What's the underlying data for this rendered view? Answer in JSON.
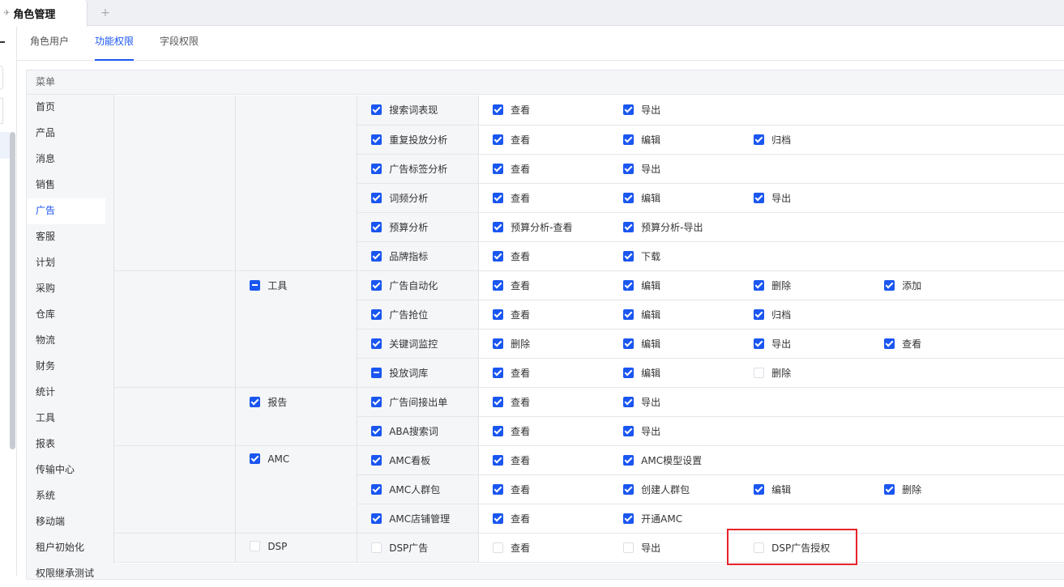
{
  "tabbar": {
    "active_tab": "角色管理",
    "add_tab": "+"
  },
  "subtabs": [
    {
      "label": "角色用户",
      "active": false
    },
    {
      "label": "功能权限",
      "active": true
    },
    {
      "label": "字段权限",
      "active": false
    }
  ],
  "panel": {
    "header": "菜单"
  },
  "menu": [
    {
      "label": "首页"
    },
    {
      "label": "产品"
    },
    {
      "label": "消息"
    },
    {
      "label": "销售"
    },
    {
      "label": "广告",
      "active": true
    },
    {
      "label": "客服"
    },
    {
      "label": "计划"
    },
    {
      "label": "采购"
    },
    {
      "label": "仓库"
    },
    {
      "label": "物流"
    },
    {
      "label": "财务"
    },
    {
      "label": "统计"
    },
    {
      "label": "工具"
    },
    {
      "label": "报表"
    },
    {
      "label": "传输中心"
    },
    {
      "label": "系统"
    },
    {
      "label": "移动端"
    },
    {
      "label": "租户初始化"
    },
    {
      "label": "权限继承测试"
    }
  ],
  "groups": [
    {
      "label": null,
      "state": null,
      "rows": [
        {
          "label": "搜索词表现",
          "state": "checked",
          "perms": [
            {
              "label": "查看",
              "state": "checked"
            },
            {
              "label": "导出",
              "state": "checked"
            }
          ]
        },
        {
          "label": "重复投放分析",
          "state": "checked",
          "perms": [
            {
              "label": "查看",
              "state": "checked"
            },
            {
              "label": "编辑",
              "state": "checked"
            },
            {
              "label": "归档",
              "state": "checked"
            }
          ]
        },
        {
          "label": "广告标签分析",
          "state": "checked",
          "perms": [
            {
              "label": "查看",
              "state": "checked"
            },
            {
              "label": "导出",
              "state": "checked"
            }
          ]
        },
        {
          "label": "词频分析",
          "state": "checked",
          "perms": [
            {
              "label": "查看",
              "state": "checked"
            },
            {
              "label": "编辑",
              "state": "checked"
            },
            {
              "label": "导出",
              "state": "checked"
            }
          ]
        },
        {
          "label": "预算分析",
          "state": "checked",
          "perms": [
            {
              "label": "预算分析-查看",
              "state": "checked"
            },
            {
              "label": "预算分析-导出",
              "state": "checked"
            }
          ]
        },
        {
          "label": "品牌指标",
          "state": "checked",
          "perms": [
            {
              "label": "查看",
              "state": "checked"
            },
            {
              "label": "下载",
              "state": "checked"
            }
          ]
        }
      ]
    },
    {
      "label": "工具",
      "state": "partial",
      "rows": [
        {
          "label": "广告自动化",
          "state": "checked",
          "perms": [
            {
              "label": "查看",
              "state": "checked"
            },
            {
              "label": "编辑",
              "state": "checked"
            },
            {
              "label": "删除",
              "state": "checked"
            },
            {
              "label": "添加",
              "state": "checked"
            }
          ]
        },
        {
          "label": "广告抢位",
          "state": "checked",
          "perms": [
            {
              "label": "查看",
              "state": "checked"
            },
            {
              "label": "编辑",
              "state": "checked"
            },
            {
              "label": "归档",
              "state": "checked"
            }
          ]
        },
        {
          "label": "关键词监控",
          "state": "checked",
          "perms": [
            {
              "label": "删除",
              "state": "checked"
            },
            {
              "label": "编辑",
              "state": "checked"
            },
            {
              "label": "导出",
              "state": "checked"
            },
            {
              "label": "查看",
              "state": "checked"
            }
          ]
        },
        {
          "label": "投放词库",
          "state": "partial",
          "perms": [
            {
              "label": "查看",
              "state": "checked"
            },
            {
              "label": "编辑",
              "state": "checked"
            },
            {
              "label": "删除",
              "state": "unchecked"
            }
          ]
        }
      ]
    },
    {
      "label": "报告",
      "state": "checked",
      "rows": [
        {
          "label": "广告间接出单",
          "state": "checked",
          "perms": [
            {
              "label": "查看",
              "state": "checked"
            },
            {
              "label": "导出",
              "state": "checked"
            }
          ]
        },
        {
          "label": "ABA搜索词",
          "state": "checked",
          "perms": [
            {
              "label": "查看",
              "state": "checked"
            },
            {
              "label": "导出",
              "state": "checked"
            }
          ]
        }
      ]
    },
    {
      "label": "AMC",
      "state": "checked",
      "rows": [
        {
          "label": "AMC看板",
          "state": "checked",
          "perms": [
            {
              "label": "查看",
              "state": "checked"
            },
            {
              "label": "AMC模型设置",
              "state": "checked"
            }
          ]
        },
        {
          "label": "AMC人群包",
          "state": "checked",
          "perms": [
            {
              "label": "查看",
              "state": "checked"
            },
            {
              "label": "创建人群包",
              "state": "checked"
            },
            {
              "label": "编辑",
              "state": "checked"
            },
            {
              "label": "删除",
              "state": "checked"
            }
          ]
        },
        {
          "label": "AMC店铺管理",
          "state": "checked",
          "perms": [
            {
              "label": "查看",
              "state": "checked"
            },
            {
              "label": "开通AMC",
              "state": "checked"
            }
          ]
        }
      ]
    },
    {
      "label": "DSP",
      "state": "unchecked",
      "rows": [
        {
          "label": "DSP广告",
          "state": "unchecked",
          "perms": [
            {
              "label": "查看",
              "state": "unchecked"
            },
            {
              "label": "导出",
              "state": "unchecked"
            },
            {
              "label": "DSP广告授权",
              "state": "unchecked"
            }
          ]
        }
      ]
    }
  ],
  "colors": {
    "accent": "#1a56f0",
    "highlight": "#e8232a"
  }
}
